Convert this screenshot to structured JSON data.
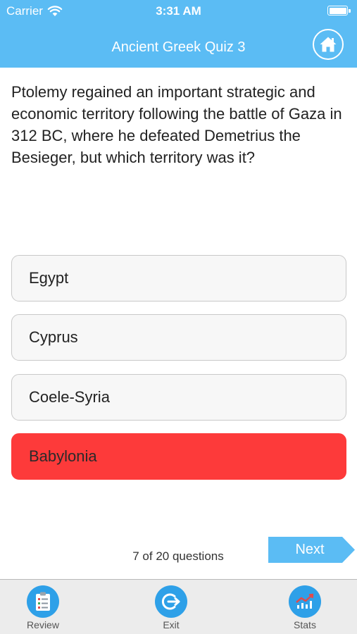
{
  "status_bar": {
    "carrier": "Carrier",
    "time": "3:31 AM"
  },
  "header": {
    "title": "Ancient Greek Quiz 3",
    "home_icon": "home-icon",
    "background_color": "#5bbcf4"
  },
  "question": {
    "text": "Ptolemy regained an important strategic and economic territory following the battle of Gaza in 312 BC, where he defeated Demetrius the Besieger, but which territory was it?"
  },
  "answers": [
    {
      "label": "Egypt",
      "state": "default"
    },
    {
      "label": "Cyprus",
      "state": "default"
    },
    {
      "label": "Coele-Syria",
      "state": "default"
    },
    {
      "label": "Babylonia",
      "state": "wrong"
    }
  ],
  "progress": {
    "text": "7 of 20 questions"
  },
  "next_button": {
    "label": "Next"
  },
  "tabbar": {
    "items": [
      {
        "label": "Review",
        "icon": "review-icon"
      },
      {
        "label": "Exit",
        "icon": "exit-icon"
      },
      {
        "label": "Stats",
        "icon": "stats-icon"
      }
    ]
  },
  "colors": {
    "accent": "#5bbcf4",
    "wrong_answer": "#fd3a3a",
    "tab_icon": "#2ea0e8"
  }
}
